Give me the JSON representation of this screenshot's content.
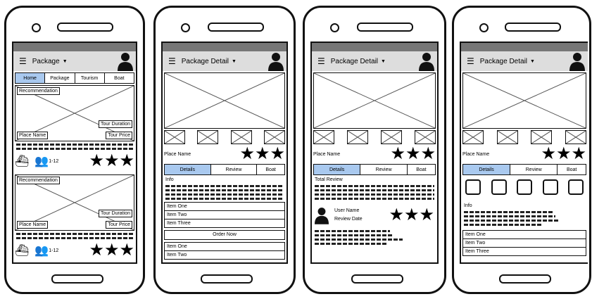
{
  "phone1": {
    "title": "Package",
    "tabs": [
      "Home",
      "Package",
      "Tourism",
      "Boat"
    ],
    "cards": [
      {
        "recommendation": "Recommendation",
        "duration": "Tour Duration",
        "place": "Place Name",
        "price": "Tour Price",
        "people": "1-12"
      },
      {
        "recommendation": "Recommendation",
        "duration": "Tour Duration",
        "place": "Place Name",
        "price": "Tour Price",
        "people": "1-12"
      }
    ]
  },
  "phone2": {
    "title": "Package Detail",
    "place": "Place Name",
    "tabs": [
      "Details",
      "Review",
      "Boat"
    ],
    "info": "Info",
    "items": [
      "Item One",
      "Item Two",
      "Item Three"
    ],
    "order_button": "Order Now",
    "items2": [
      "Item One",
      "Item Two"
    ]
  },
  "phone3": {
    "title": "Package Detail",
    "place": "Place Name",
    "tabs": [
      "Details",
      "Review",
      "Boat"
    ],
    "total_review": "Total Review",
    "user_name": "User Name",
    "review_date": "Review Date"
  },
  "phone4": {
    "title": "Package Detail",
    "place": "Place Name",
    "tabs": [
      "Details",
      "Review",
      "Boat"
    ],
    "info": "Info",
    "items": [
      "Item One",
      "Item Two",
      "Item Three"
    ]
  }
}
